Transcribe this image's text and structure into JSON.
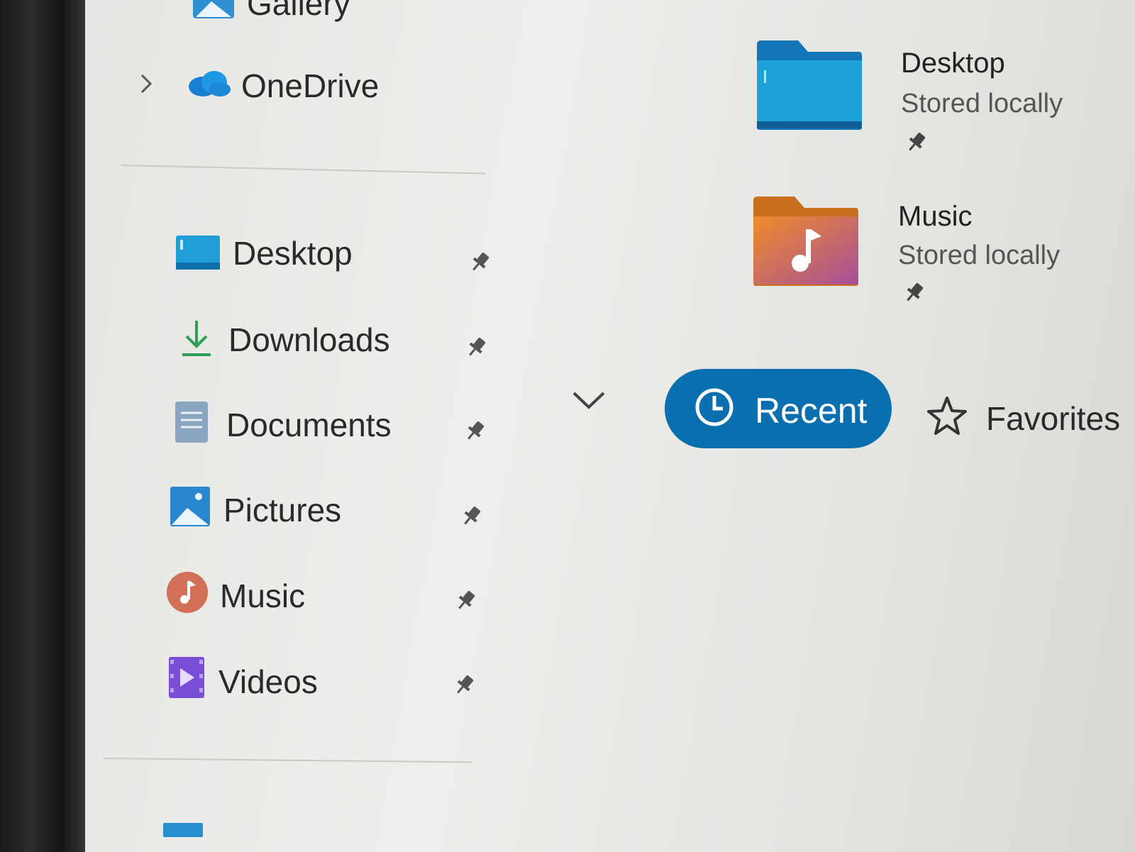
{
  "sidebar": {
    "gallery_label": "Gallery",
    "onedrive_label": "OneDrive",
    "items": [
      {
        "label": "Desktop",
        "icon": "desktop-icon"
      },
      {
        "label": "Downloads",
        "icon": "download-arrow-icon"
      },
      {
        "label": "Documents",
        "icon": "document-icon"
      },
      {
        "label": "Pictures",
        "icon": "pictures-icon"
      },
      {
        "label": "Music",
        "icon": "music-icon"
      },
      {
        "label": "Videos",
        "icon": "videos-icon"
      }
    ]
  },
  "quick_access": {
    "tiles": [
      {
        "name": "Desktop",
        "status": "Stored locally",
        "icon": "desktop-folder-icon"
      },
      {
        "name": "Music",
        "status": "Stored locally",
        "icon": "music-folder-icon"
      }
    ]
  },
  "tabs": {
    "recent_label": "Recent",
    "favorites_label": "Favorites"
  },
  "colors": {
    "accent": "#0a6fae",
    "desktop_blue": "#1f9fd6",
    "download_green": "#2e9e58",
    "music_orange": "#e4813a",
    "videos_purple": "#7a4fd6"
  }
}
